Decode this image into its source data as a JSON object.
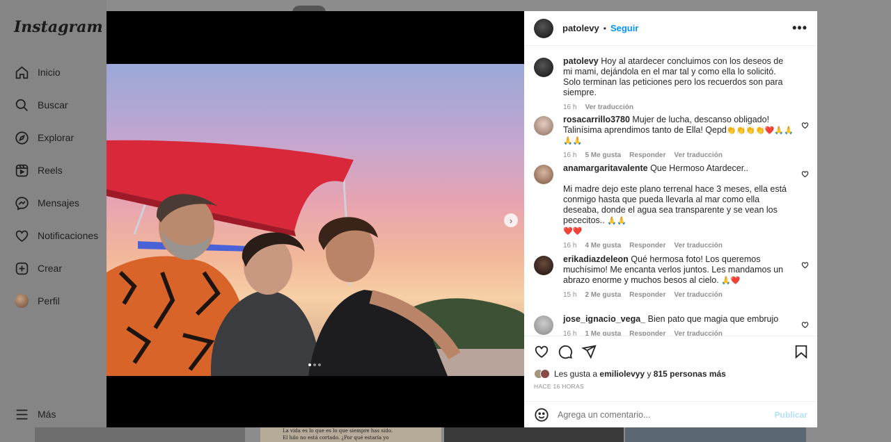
{
  "app": {
    "logo": "Instagram"
  },
  "sidebar": {
    "items": [
      {
        "label": "Inicio",
        "icon": "home-icon"
      },
      {
        "label": "Buscar",
        "icon": "search-icon"
      },
      {
        "label": "Explorar",
        "icon": "compass-icon"
      },
      {
        "label": "Reels",
        "icon": "reels-icon"
      },
      {
        "label": "Mensajes",
        "icon": "messenger-icon"
      },
      {
        "label": "Notificaciones",
        "icon": "heart-icon"
      },
      {
        "label": "Crear",
        "icon": "plus-square-icon"
      },
      {
        "label": "Perfil",
        "icon": "avatar"
      }
    ],
    "more_label": "Más"
  },
  "background": {
    "caption_line1": "La vida es lo que es lo que siempre has sido.",
    "caption_line2": "El hilo no está cortado. ¿Por qué estaría yo"
  },
  "post": {
    "author": "patolevy",
    "separator": "•",
    "follow_label": "Seguir",
    "more_label": "•••",
    "carousel_dots": 3,
    "active_dot": 0,
    "caption": {
      "user": "patolevy",
      "text": "Hoy al atardecer concluimos con los deseos de mi mami, dejándola en el mar tal y como ella lo solicitó. Solo terminan las peticiones pero los recuerdos son para siempre.",
      "time": "16 h",
      "translate": "Ver traducción"
    },
    "comments": [
      {
        "user": "rosacarrillo3780",
        "text": "Mujer de lucha, descanso obligado! Talinísima aprendimos tanto de Ella! Qepd",
        "emoji": "👏👏👏👏❤️🙏🙏🙏🙏",
        "time": "16 h",
        "likes": "5 Me gusta",
        "reply": "Responder",
        "translate": "Ver traducción"
      },
      {
        "user": "anamargaritavalente",
        "text": "Que Hermoso Atardecer..",
        "text2": "Mi madre dejo este plano terrenal hace 3 meses, ella está conmigo hasta que pueda llevarla al mar como ella deseaba, donde el agua sea transparente y se vean los pececitos..",
        "emoji": "🙏🙏",
        "emoji2": "❤️❤️",
        "time": "16 h",
        "likes": "4 Me gusta",
        "reply": "Responder",
        "translate": "Ver traducción"
      },
      {
        "user": "erikadiazdeleon",
        "text": "Qué hermosa foto! Los queremos muchísimo! Me encanta verlos juntos. Les mandamos un abrazo enorme y muchos besos al cielo.",
        "emoji": "🙏❤️",
        "time": "15 h",
        "likes": "2 Me gusta",
        "reply": "Responder",
        "translate": "Ver traducción"
      },
      {
        "user": "jose_ignacio_vega_",
        "text": "Bien pato que magia que embrujo",
        "time": "16 h",
        "likes": "1 Me gusta",
        "reply": "Responder",
        "translate": "Ver traducción"
      }
    ],
    "likes": {
      "prefix": "Les gusta a",
      "user": "emiliolevyy",
      "middle": "y",
      "others": "815 personas más"
    },
    "time_ago": "HACE 16 HORAS",
    "add_comment_placeholder": "Agrega un comentario...",
    "publish_label": "Publicar"
  },
  "colors": {
    "link": "#0095f6",
    "publish_disabled": "#b2dffc",
    "canopy": "#d8283a"
  }
}
